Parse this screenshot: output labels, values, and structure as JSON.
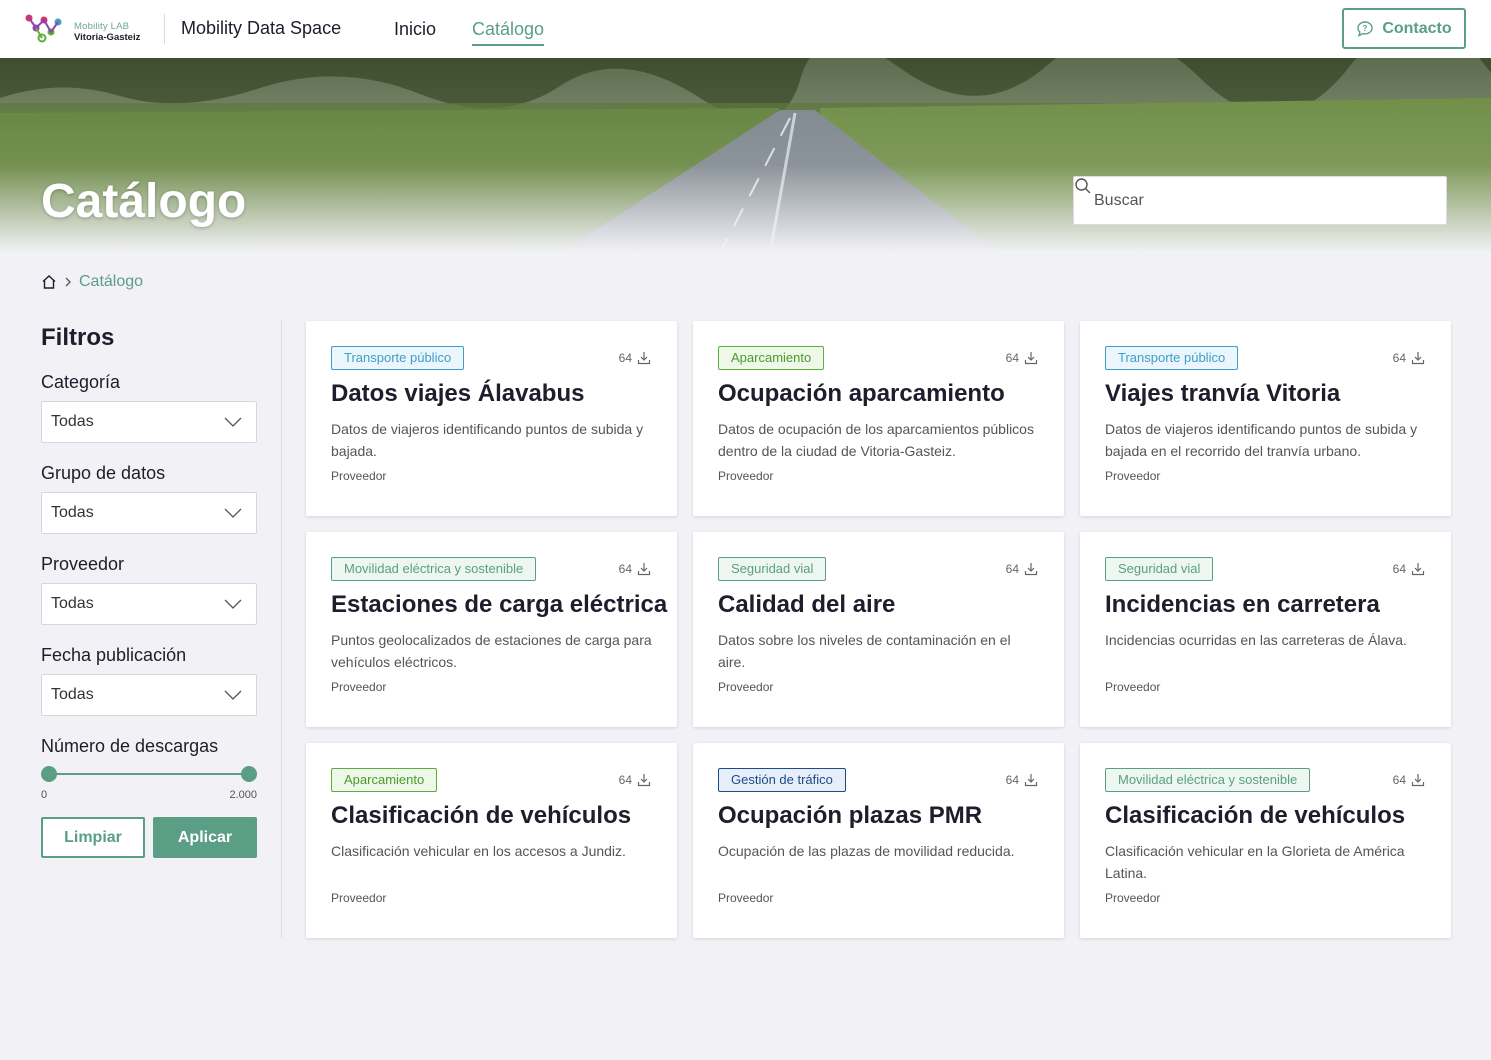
{
  "header": {
    "logo_line1": "Mobility LAB",
    "logo_line2": "Vitoria-Gasteiz",
    "site_title": "Mobility Data Space",
    "nav": {
      "home": "Inicio",
      "catalog": "Catálogo"
    },
    "contact_label": "Contacto"
  },
  "hero": {
    "title": "Catálogo",
    "search_placeholder": "Buscar"
  },
  "breadcrumb": {
    "current": "Catálogo"
  },
  "filters": {
    "title": "Filtros",
    "category": {
      "label": "Categoría",
      "value": "Todas"
    },
    "data_group": {
      "label": "Grupo de datos",
      "value": "Todas"
    },
    "provider": {
      "label": "Proveedor",
      "value": "Todas"
    },
    "pub_date": {
      "label": "Fecha publicación",
      "value": "Todas"
    },
    "downloads": {
      "label": "Número de descargas",
      "min": "0",
      "max": "2.000"
    },
    "clear_label": "Limpiar",
    "apply_label": "Aplicar"
  },
  "colors": {
    "accent": "#5a9e86",
    "tag_transporte": "#3d9fc7",
    "tag_aparcamiento": "#5bb03a",
    "tag_gestion": "#1f4a8a"
  },
  "cards": [
    {
      "tag": "Transporte público",
      "tag_type": "transporte",
      "downloads": "64",
      "title": "Datos viajes Álavabus",
      "desc": "Datos de viajeros identificando puntos de subida y bajada.",
      "provider": "Proveedor"
    },
    {
      "tag": "Aparcamiento",
      "tag_type": "aparcamiento",
      "downloads": "64",
      "title": "Ocupación aparcamiento",
      "desc": "Datos de ocupación de los aparcamientos públicos dentro de la ciudad de Vitoria-Gasteiz.",
      "provider": "Proveedor"
    },
    {
      "tag": "Transporte público",
      "tag_type": "transporte",
      "downloads": "64",
      "title": "Viajes tranvía Vitoria",
      "desc": "Datos de viajeros identificando puntos de subida y bajada en el recorrido del tranvía urbano.",
      "provider": "Proveedor"
    },
    {
      "tag": "Movilidad eléctrica y sostenible",
      "tag_type": "movilidad",
      "downloads": "64",
      "title": "Estaciones de carga eléctrica",
      "desc": "Puntos geolocalizados de estaciones de carga para vehículos eléctricos.",
      "provider": "Proveedor"
    },
    {
      "tag": "Seguridad vial",
      "tag_type": "seguridad",
      "downloads": "64",
      "title": "Calidad del aire",
      "desc": "Datos sobre los niveles de contaminación en el aire.",
      "provider": "Proveedor"
    },
    {
      "tag": "Seguridad vial",
      "tag_type": "seguridad",
      "downloads": "64",
      "title": "Incidencias en carretera",
      "desc": "Incidencias ocurridas en las carreteras de Álava.",
      "provider": "Proveedor"
    },
    {
      "tag": "Aparcamiento",
      "tag_type": "aparcamiento",
      "downloads": "64",
      "title": "Clasificación de vehículos",
      "desc": "Clasificación vehicular en los accesos a Jundiz.",
      "provider": "Proveedor"
    },
    {
      "tag": "Gestión de tráfico",
      "tag_type": "gestion",
      "downloads": "64",
      "title": "Ocupación plazas PMR",
      "desc": "Ocupación de las plazas de movilidad reducida.",
      "provider": "Proveedor"
    },
    {
      "tag": "Movilidad eléctrica y sostenible",
      "tag_type": "movilidad",
      "downloads": "64",
      "title": "Clasificación de vehículos",
      "desc": "Clasificación vehicular en la Glorieta de América Latina.",
      "provider": "Proveedor"
    }
  ]
}
